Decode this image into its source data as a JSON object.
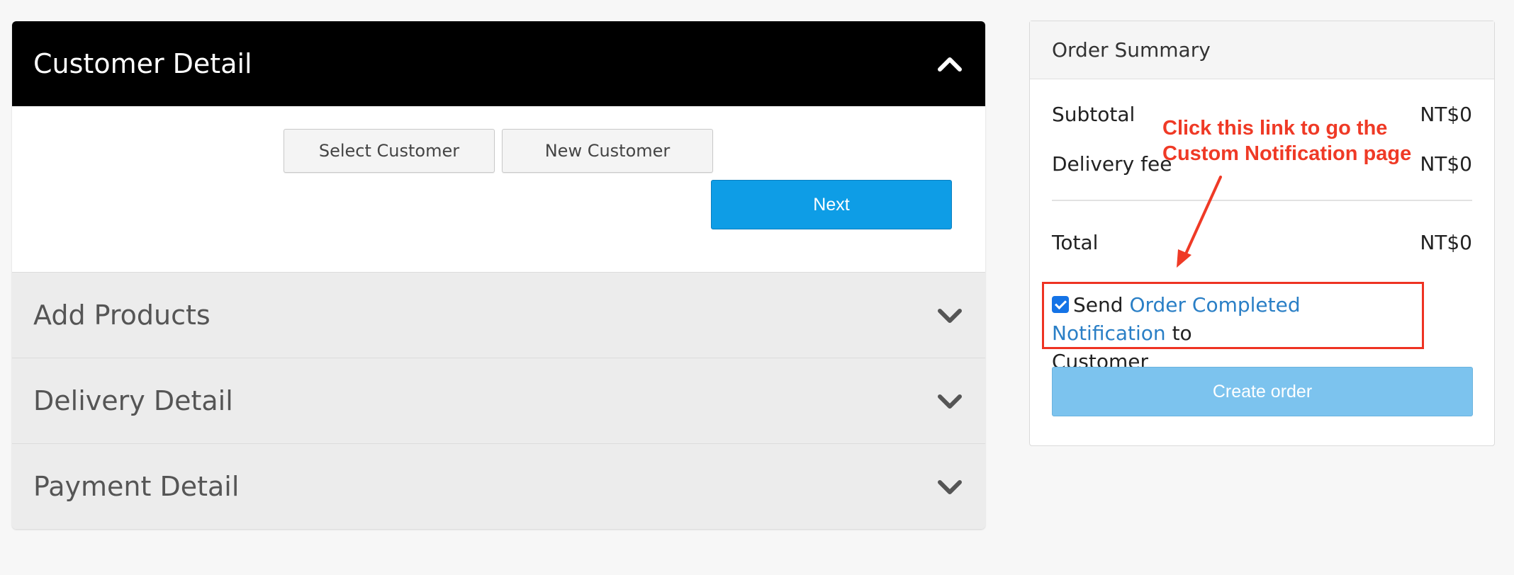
{
  "customer_detail": {
    "title": "Customer Detail",
    "select_customer": "Select Customer",
    "new_customer": "New Customer",
    "next": "Next"
  },
  "sections": [
    {
      "title": "Add Products"
    },
    {
      "title": "Delivery Detail"
    },
    {
      "title": "Payment Detail"
    }
  ],
  "order_summary": {
    "title": "Order Summary",
    "subtotal_label": "Subtotal",
    "subtotal_value": "NT$0",
    "delivery_label": "Delivery fee",
    "delivery_value": "NT$0",
    "total_label": "Total",
    "total_value": "NT$0",
    "notify_prefix": "Send",
    "notify_link": "Order Completed Notification",
    "notify_suffix": "to",
    "notify_line2": "Customer",
    "notify_checked": true,
    "create_order": "Create order"
  },
  "annotation": {
    "text": "Click this link to go the\nCustom Notification page",
    "color": "#ef3a26"
  },
  "colors": {
    "primary": "#0e9de6",
    "primary_disabled": "#7cc3ee",
    "link": "#2a7fc6"
  },
  "icons": {
    "collapse": "chevron-up-icon",
    "expand": "chevron-down-icon",
    "checkbox": "checkbox-checked-icon"
  }
}
